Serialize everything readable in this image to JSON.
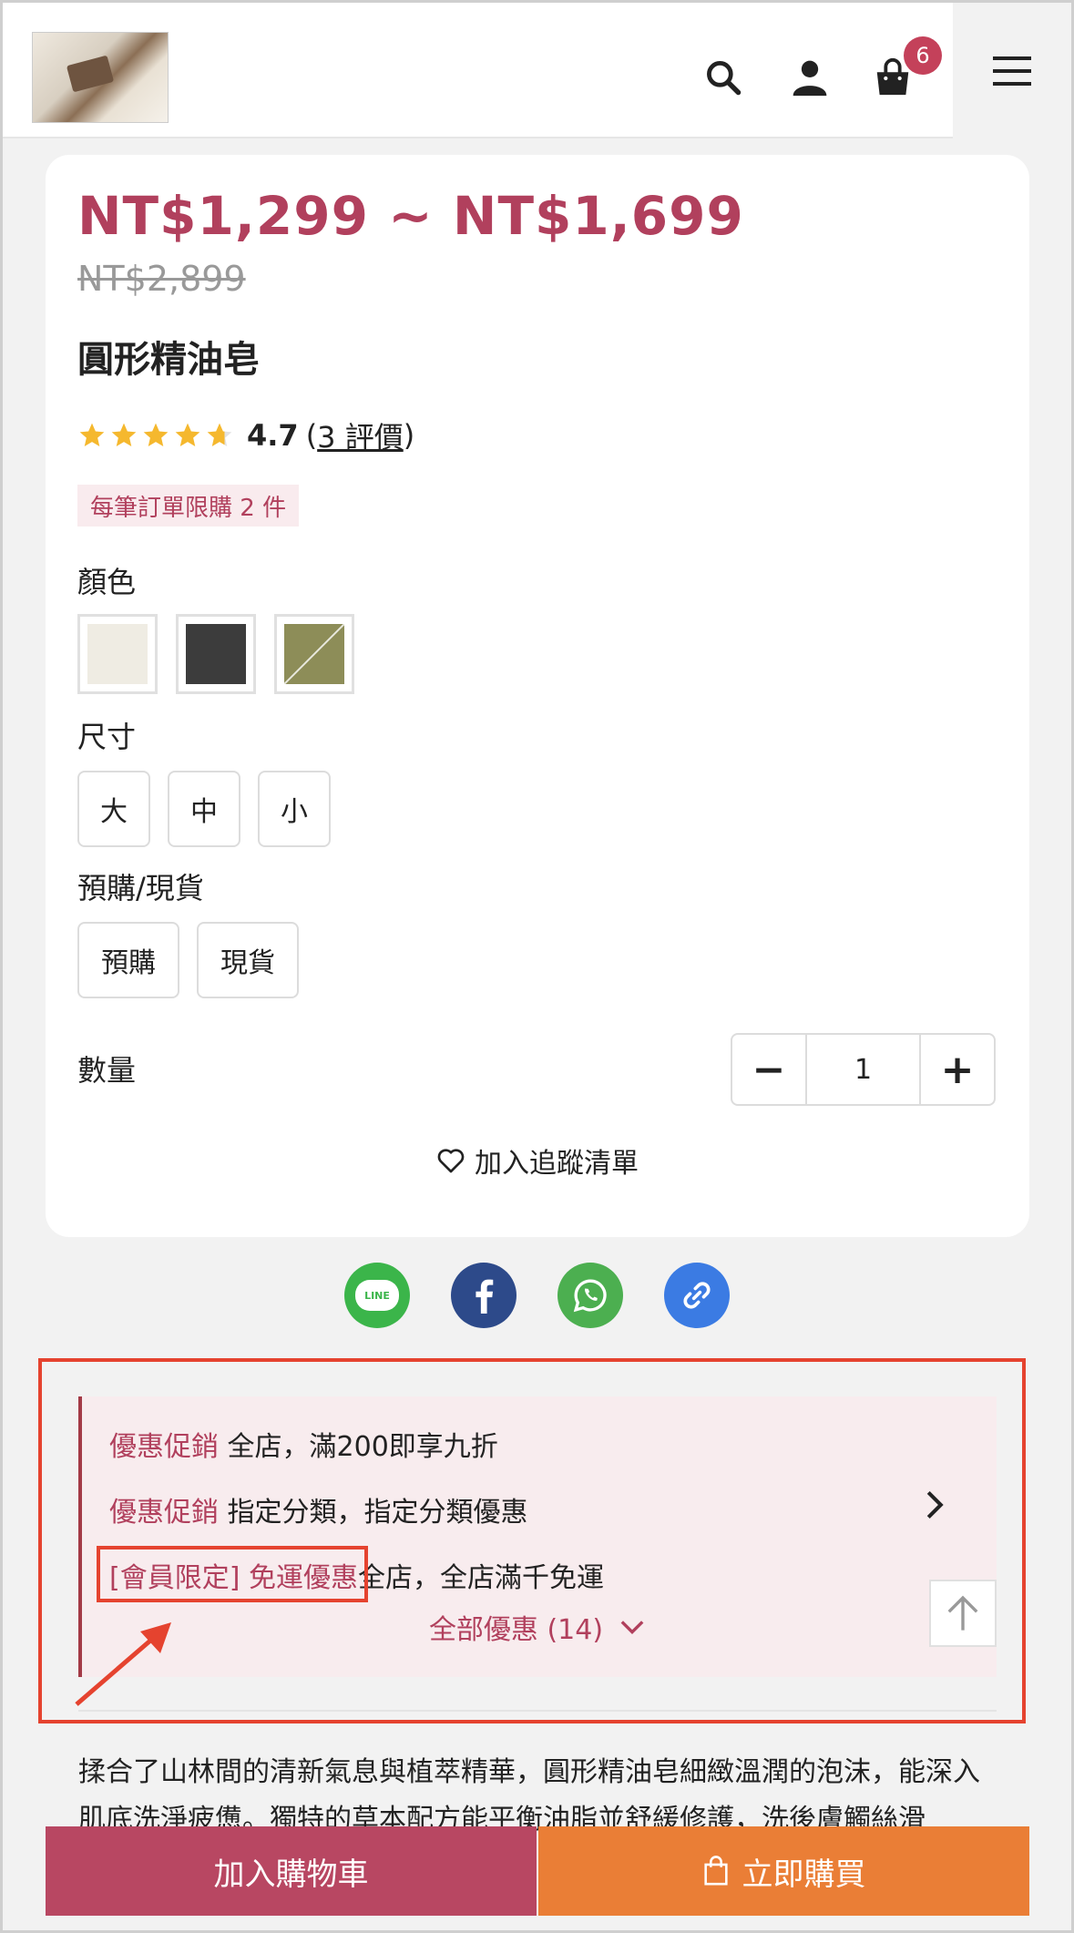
{
  "header": {
    "cart_count": "6"
  },
  "product": {
    "price_range": "NT$1,299 ~ NT$1,699",
    "original_price": "NT$2,899",
    "title": "圓形精油皂",
    "rating": {
      "stars": 4.7,
      "score_label": "4.7",
      "open_paren": "(",
      "reviews_link": "3 評價",
      "close_paren": ")"
    },
    "limit_badge": "每筆訂單限購 2 件",
    "color_label": "顏色",
    "colors": [
      {
        "color": "#efece3",
        "available": true
      },
      {
        "color": "#3c3c3c",
        "available": true
      },
      {
        "color": "#8d8d58",
        "available": false
      }
    ],
    "size_label": "尺寸",
    "sizes": [
      "大",
      "中",
      "小"
    ],
    "stock_label": "預購/現貨",
    "stock_options": [
      "預購",
      "現貨"
    ],
    "quantity_label": "數量",
    "quantity": "1",
    "qty_minus": "−",
    "qty_plus": "+",
    "wishlist_label": "加入追蹤清單"
  },
  "share": {
    "line_label": "LINE",
    "colors": {
      "line": "#3bb54a",
      "facebook": "#2d4a8a",
      "whatsapp": "#4caf50",
      "link": "#3b7be3"
    }
  },
  "promotions": {
    "items": [
      {
        "tag": "優惠促銷",
        "text": " 全店，滿200即享九折"
      },
      {
        "tag": "優惠促銷",
        "text": " 指定分類，指定分類優惠"
      },
      {
        "tag": "[會員限定] 免運優惠",
        "text": "全店，全店滿千免運"
      }
    ],
    "show_all": "全部優惠 (14)"
  },
  "description": "揉合了山林間的清新氣息與植萃精華，圓形精油皂細緻溫潤的泡沫，能深入肌底洗淨疲憊。獨特的草本配方能平衡油脂並舒緩修護，洗後膚觸絲滑",
  "actions": {
    "add_to_cart": "加入購物車",
    "buy_now": "立即購買"
  },
  "theme": {
    "accent": "#b1405d",
    "annotation": "#e5432f",
    "buy_now": "#ea7e36",
    "add_to_cart": "#b84762"
  }
}
